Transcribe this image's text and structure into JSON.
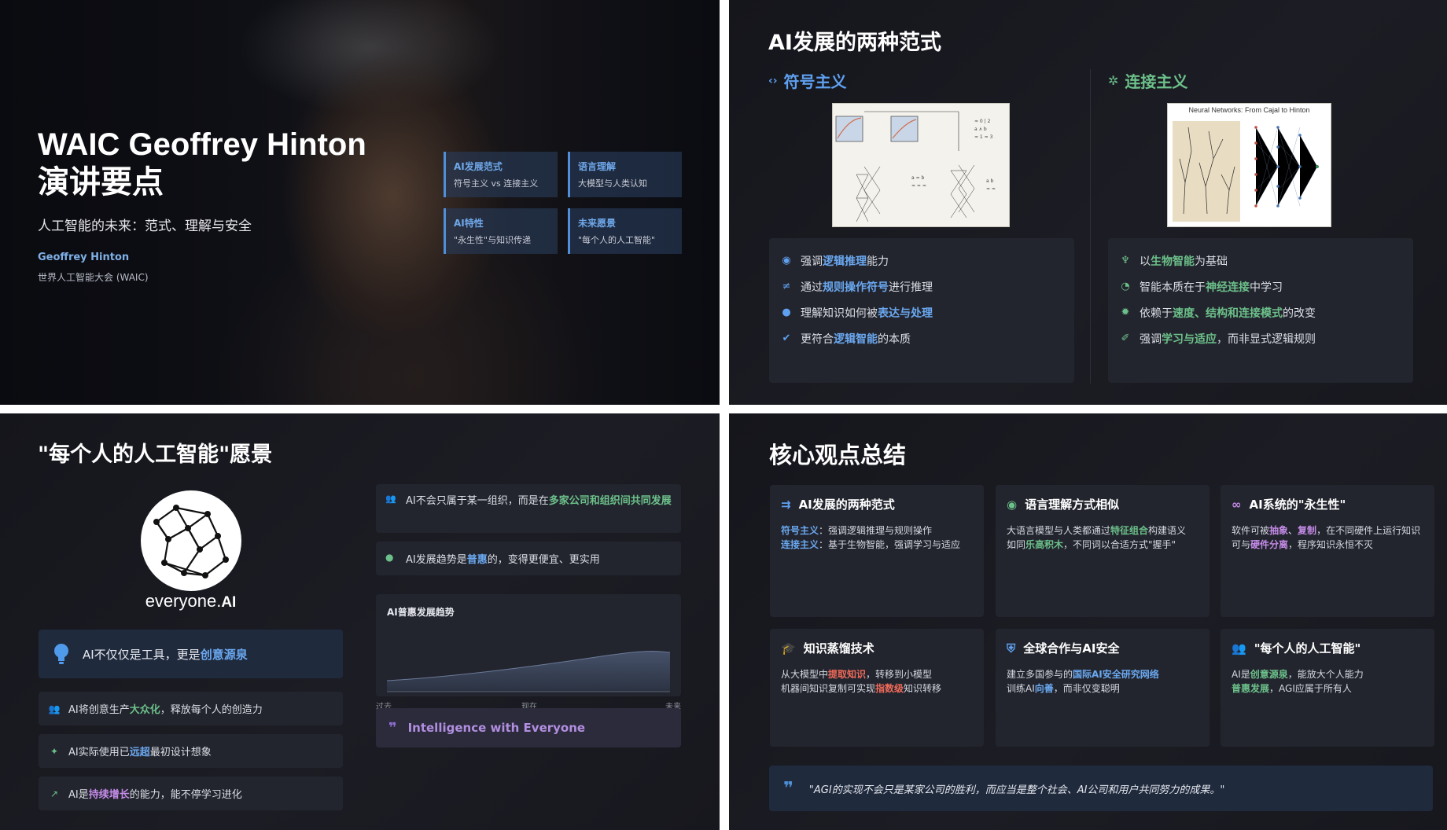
{
  "slide1": {
    "title_line1": "WAIC Geoffrey Hinton",
    "title_line2": "演讲要点",
    "subtitle": "人工智能的未来：范式、理解与安全",
    "speaker": "Geoffrey Hinton",
    "event": "世界人工智能大会 (WAIC)",
    "tags": [
      {
        "title": "AI发展范式",
        "desc": "符号主义 vs 连接主义"
      },
      {
        "title": "语言理解",
        "desc": "大模型与人类认知"
      },
      {
        "title": "AI特性",
        "desc": "\"永生性\"与知识传递"
      },
      {
        "title": "未来愿景",
        "desc": "\"每个人的人工智能\""
      }
    ]
  },
  "slide2": {
    "title": "AI发展的两种范式",
    "left_head": "符号主义",
    "right_head": "连接主义",
    "right_image_caption": "Neural Networks: From Cajal to Hinton",
    "left_items": [
      {
        "pre": "强调",
        "hl": "逻辑推理",
        "post": "能力"
      },
      {
        "pre": "通过",
        "hl": "规则操作符号",
        "post": "进行推理"
      },
      {
        "pre": "理解知识如何被",
        "hl": "表达与处理",
        "post": ""
      },
      {
        "pre": "更符合",
        "hl": "逻辑智能",
        "post": "的本质"
      }
    ],
    "right_items": [
      {
        "pre": "以",
        "hl": "生物智能",
        "post": "为基础"
      },
      {
        "pre": "智能本质在于",
        "hl": "神经连接",
        "post": "中学习"
      },
      {
        "pre": "依赖于",
        "hl": "速度、结构和连接模式",
        "post": "的改变"
      },
      {
        "pre": "强调",
        "hl": "学习与适应",
        "post": "，而非显式逻辑规则"
      }
    ]
  },
  "slide3": {
    "title": "\"每个人的人工智能\"愿景",
    "brand_main": "everyone.",
    "brand_ai": "AI",
    "tool_pre": "AI不仅仅是工具，更是",
    "tool_hl": "创意源泉",
    "rows": [
      {
        "pre": "AI将创意生产",
        "hl": "大众化",
        "post": "，释放每个人的创造力"
      },
      {
        "pre": "AI实际使用已",
        "hl": "远超",
        "post": "最初设计想象"
      },
      {
        "pre": "AI是",
        "hl": "持续增长",
        "post": "的能力，能不停学习进化"
      }
    ],
    "right_item1_pre": "AI不会只属于某一组织，而是在",
    "right_item1_hl": "多家公司和组织间共同发展",
    "right_item2_pre": "AI发展趋势是",
    "right_item2_hl": "普惠",
    "right_item2_post": "的，变得更便宜、更实用",
    "chart_title": "AI普惠发展趋势",
    "axis_labels": [
      "过去",
      "现在",
      "未来"
    ],
    "quote": "Intelligence with Everyone"
  },
  "slide4": {
    "title": "核心观点总结",
    "cards": [
      {
        "title": "AI发展的两种范式"
      },
      {
        "title": "语言理解方式相似"
      },
      {
        "title": "AI系统的\"永生性\""
      },
      {
        "title": "知识蒸馏技术"
      },
      {
        "title": "全球合作与AI安全"
      },
      {
        "title": "\"每个人的人工智能\""
      }
    ],
    "c1_l1_hl": "符号主义",
    "c1_l1": "：强调逻辑推理与规则操作",
    "c1_l2_hl": "连接主义",
    "c1_l2": "：基于生物智能，强调学习与适应",
    "c2_l1_pre": "大语言模型与人类都通过",
    "c2_l1_hl": "特征组合",
    "c2_l1_post": "构建语义",
    "c2_l2_pre": "如同",
    "c2_l2_hl": "乐高积木",
    "c2_l2_post": "，不同词以合适方式\"握手\"",
    "c3_pre": "软件可被",
    "c3_hl1": "抽象",
    "c3_mid": "、",
    "c3_hl2": "复制",
    "c3_mid2": "，在不同硬件上运行知识可与",
    "c3_hl3": "硬件分离",
    "c3_post": "，程序知识永恒不灭",
    "c4_l1_pre": "从大模型中",
    "c4_l1_hl": "提取知识",
    "c4_l1_post": "，转移到小模型",
    "c4_l2_pre": "机器间知识复制可实现",
    "c4_l2_hl": "指数级",
    "c4_l2_post": "知识转移",
    "c5_l1_pre": "建立多国参与的",
    "c5_l1_hl": "国际AI安全研究网络",
    "c5_l1_post": "",
    "c5_l2_pre": "训练AI",
    "c5_l2_hl": "向善",
    "c5_l2_post": "，而非仅变聪明",
    "c6_l1_pre": "AI是",
    "c6_l1_hl": "创意源泉",
    "c6_l1_post": "，能放大个人能力",
    "c6_l2_hl": "普惠发展",
    "c6_l2_post": "，AGI应属于所有人",
    "quote": "\"AGI的实现不会只是某家公司的胜利，而应当是整个社会、AI公司和用户共同努力的成果。\""
  }
}
